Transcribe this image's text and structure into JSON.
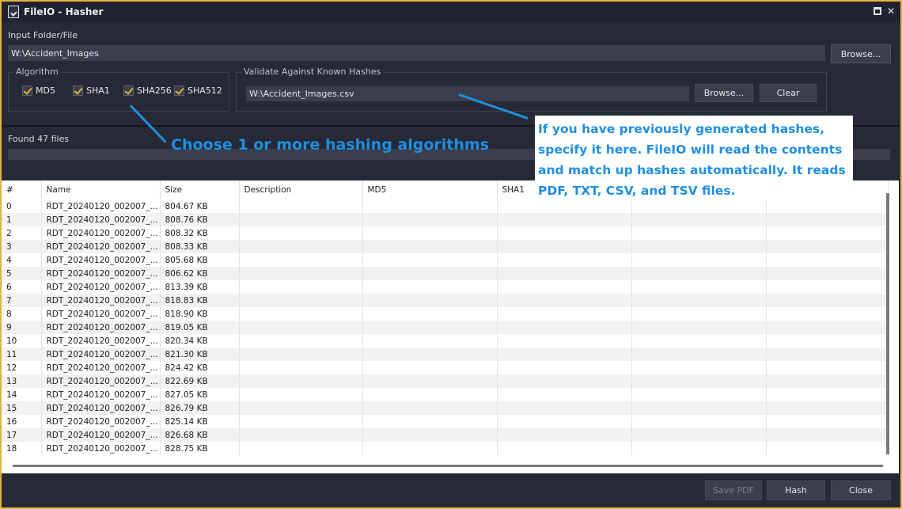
{
  "window": {
    "title": "FileIO - Hasher"
  },
  "input": {
    "label": "Input Folder/File",
    "value": "W:\\Accident_Images",
    "browse_label": "Browse..."
  },
  "algorithm": {
    "label": "Algorithm",
    "options": [
      {
        "label": "MD5",
        "checked": true
      },
      {
        "label": "SHA1",
        "checked": true
      },
      {
        "label": "SHA256",
        "checked": true
      },
      {
        "label": "SHA512",
        "checked": true
      }
    ]
  },
  "validate": {
    "label": "Validate Against Known Hashes",
    "value": "W:\\Accident_Images.csv",
    "browse_label": "Browse...",
    "clear_label": "Clear"
  },
  "status": {
    "found_text": "Found 47 files"
  },
  "table": {
    "columns": [
      "#",
      "Name",
      "Size",
      "Description",
      "MD5",
      "SHA1",
      "",
      ""
    ],
    "rows": [
      {
        "n": "0",
        "name": "RDT_20240120_002007_...",
        "size": "804.67 KB"
      },
      {
        "n": "1",
        "name": "RDT_20240120_002007_...",
        "size": "808.76 KB"
      },
      {
        "n": "2",
        "name": "RDT_20240120_002007_...",
        "size": "808.32 KB"
      },
      {
        "n": "3",
        "name": "RDT_20240120_002007_...",
        "size": "808.33 KB"
      },
      {
        "n": "4",
        "name": "RDT_20240120_002007_...",
        "size": "805.68 KB"
      },
      {
        "n": "5",
        "name": "RDT_20240120_002007_...",
        "size": "806.62 KB"
      },
      {
        "n": "6",
        "name": "RDT_20240120_002007_...",
        "size": "813.39 KB"
      },
      {
        "n": "7",
        "name": "RDT_20240120_002007_...",
        "size": "818.83 KB"
      },
      {
        "n": "8",
        "name": "RDT_20240120_002007_...",
        "size": "818.90 KB"
      },
      {
        "n": "9",
        "name": "RDT_20240120_002007_...",
        "size": "819.05 KB"
      },
      {
        "n": "10",
        "name": "RDT_20240120_002007_...",
        "size": "820.34 KB"
      },
      {
        "n": "11",
        "name": "RDT_20240120_002007_...",
        "size": "821.30 KB"
      },
      {
        "n": "12",
        "name": "RDT_20240120_002007_...",
        "size": "824.42 KB"
      },
      {
        "n": "13",
        "name": "RDT_20240120_002007_...",
        "size": "822.69 KB"
      },
      {
        "n": "14",
        "name": "RDT_20240120_002007_...",
        "size": "827.05 KB"
      },
      {
        "n": "15",
        "name": "RDT_20240120_002007_...",
        "size": "826.79 KB"
      },
      {
        "n": "16",
        "name": "RDT_20240120_002007_...",
        "size": "825.14 KB"
      },
      {
        "n": "17",
        "name": "RDT_20240120_002007_...",
        "size": "826.68 KB"
      },
      {
        "n": "18",
        "name": "RDT_20240120_002007_...",
        "size": "828.75 KB"
      }
    ]
  },
  "footer": {
    "save_pdf_label": "Save PDF",
    "hash_label": "Hash",
    "close_label": "Close"
  },
  "annotations": {
    "algorithm_hint": "Choose 1 or more hashing algorithms",
    "validate_hint": "If you have previously generated hashes, specify it here. FileIO will read the contents and match up hashes automatically.  It reads PDF, TXT, CSV, and TSV files."
  },
  "colors": {
    "accent": "#e3b33b",
    "annotation": "#1f8fe0",
    "background": "#262a37",
    "field": "#3a3e4d"
  },
  "icons": {
    "app": "file-check-icon",
    "maximize": "maximize-icon",
    "close": "close-icon"
  }
}
